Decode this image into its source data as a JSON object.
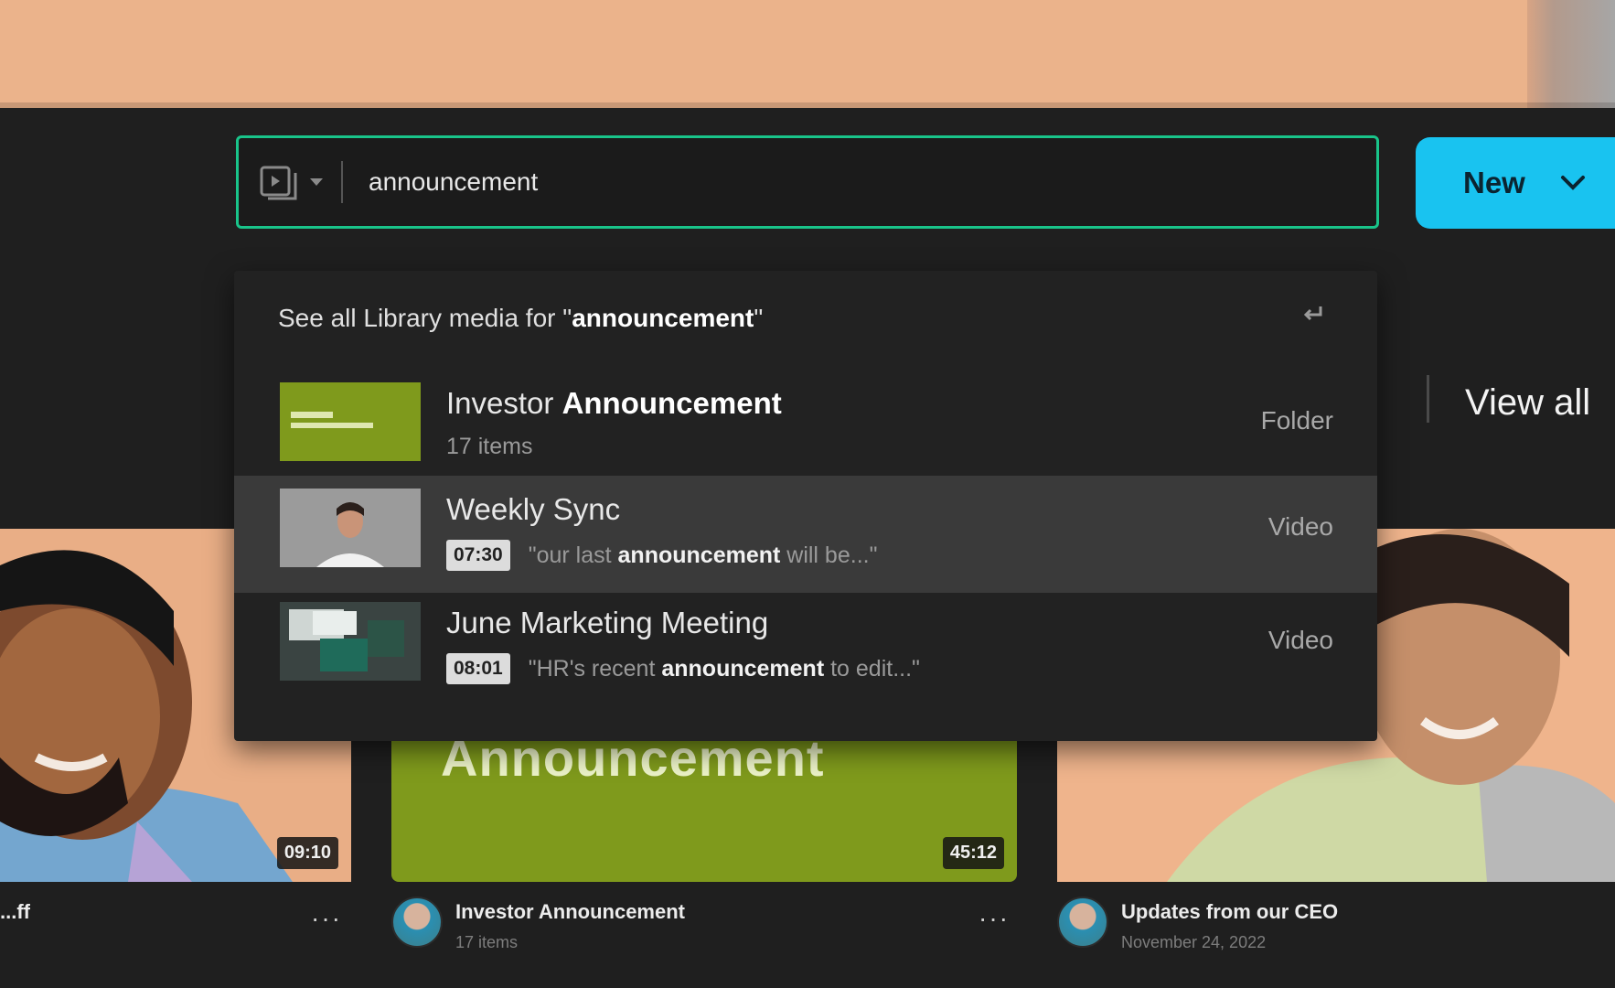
{
  "search": {
    "value": "announcement",
    "placeholder": ""
  },
  "new_button": {
    "label": "New"
  },
  "dropdown": {
    "see_all_prefix": "See all Library media for \"",
    "see_all_query": "announcement",
    "see_all_suffix": "\"",
    "results": [
      {
        "title_plain": "Investor ",
        "title_bold": "Announcement",
        "subtitle": "17 items",
        "type": "Folder"
      },
      {
        "title_plain": "Weekly Sync",
        "timestamp": "07:30",
        "snippet_pre": "\"our last ",
        "snippet_bold": "announcement",
        "snippet_post": " will be...\"",
        "type": "Video"
      },
      {
        "title_plain": "June Marketing Meeting",
        "timestamp": "08:01",
        "snippet_pre": "\"HR's recent ",
        "snippet_bold": "announcement",
        "snippet_post": " to edit...\"",
        "type": "Video"
      }
    ]
  },
  "view_all": {
    "label": "View all"
  },
  "cards": [
    {
      "title": "...ff",
      "duration": "09:10"
    },
    {
      "title": "Investor Announcement",
      "subtitle": "17 items",
      "duration": "45:12",
      "image_text": "Announcement"
    },
    {
      "title": "Updates from our CEO",
      "subtitle": "November 24, 2022"
    }
  ],
  "colors": {
    "accent_green": "#19c48a",
    "new_button": "#19c3f0",
    "folder_thumb": "#7f9a1c"
  }
}
